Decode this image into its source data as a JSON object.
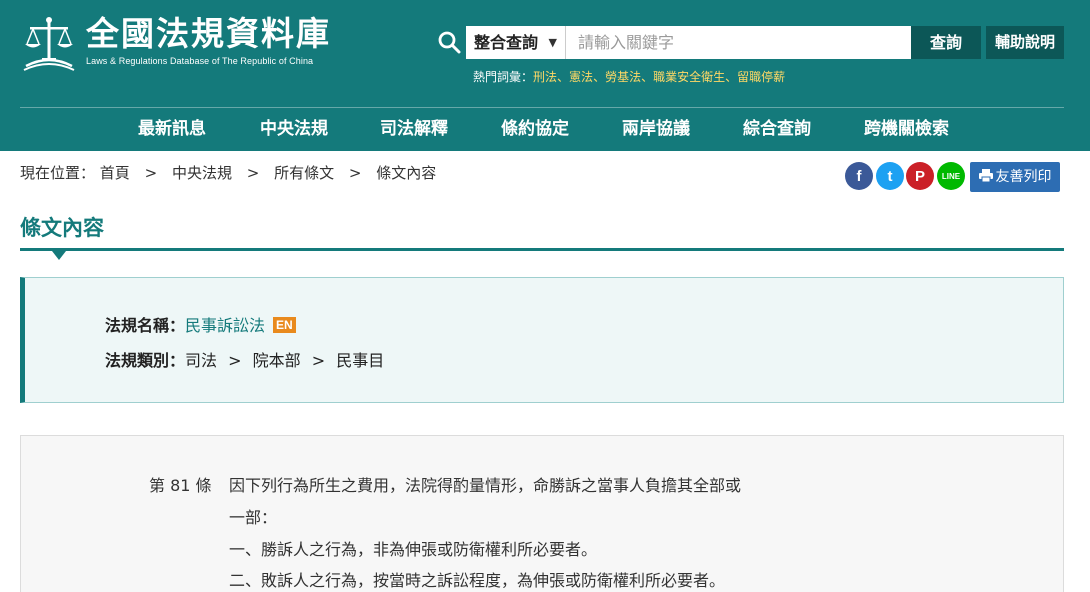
{
  "site": {
    "title": "全國法規資料庫",
    "subtitle": "Laws & Regulations Database of The Republic of China"
  },
  "search": {
    "scope": "整合查詢",
    "placeholder": "請輸入關鍵字",
    "query_label": "查詢",
    "help_label": "輔助說明"
  },
  "hot_keywords": {
    "label": "熱門詞彙：",
    "items": [
      "刑法",
      "憲法",
      "勞基法",
      "職業安全衛生",
      "留職停薪"
    ]
  },
  "nav": [
    "最新訊息",
    "中央法規",
    "司法解釋",
    "條約協定",
    "兩岸協議",
    "綜合查詢",
    "跨機關檢索"
  ],
  "breadcrumb": {
    "label": "現在位置：",
    "items": [
      "首頁",
      "中央法規",
      "所有條文",
      "條文內容"
    ],
    "separator": ">"
  },
  "share": {
    "facebook": "f",
    "twitter": "t",
    "pinterest": "P",
    "line": "LINE",
    "print_label": "友善列印"
  },
  "page_title": "條文內容",
  "law_info": {
    "name_label": "法規名稱：",
    "name": "民事訴訟法",
    "en_badge": "EN",
    "category_label": "法規類別：",
    "category": [
      "司法",
      "院本部",
      "民事目"
    ],
    "category_separator": ">"
  },
  "article": {
    "number": "第 81 條",
    "lines": [
      "因下列行為所生之費用，法院得酌量情形，命勝訴之當事人負擔其全部或",
      "一部：",
      "一、勝訴人之行為，非為伸張或防衛權利所必要者。",
      "二、敗訴人之行為，按當時之訴訟程度，為伸張或防衛權利所必要者。"
    ]
  },
  "colors": {
    "header_bg": "#147a7b",
    "accent": "#147a7b",
    "dark_button": "#0c5757",
    "hot_keyword": "#ffd966",
    "en_badge": "#e98a1d",
    "print_button": "#2d6db3",
    "facebook": "#3b5998",
    "twitter": "#1da1f2",
    "pinterest": "#cb2027",
    "line": "#00b900"
  }
}
